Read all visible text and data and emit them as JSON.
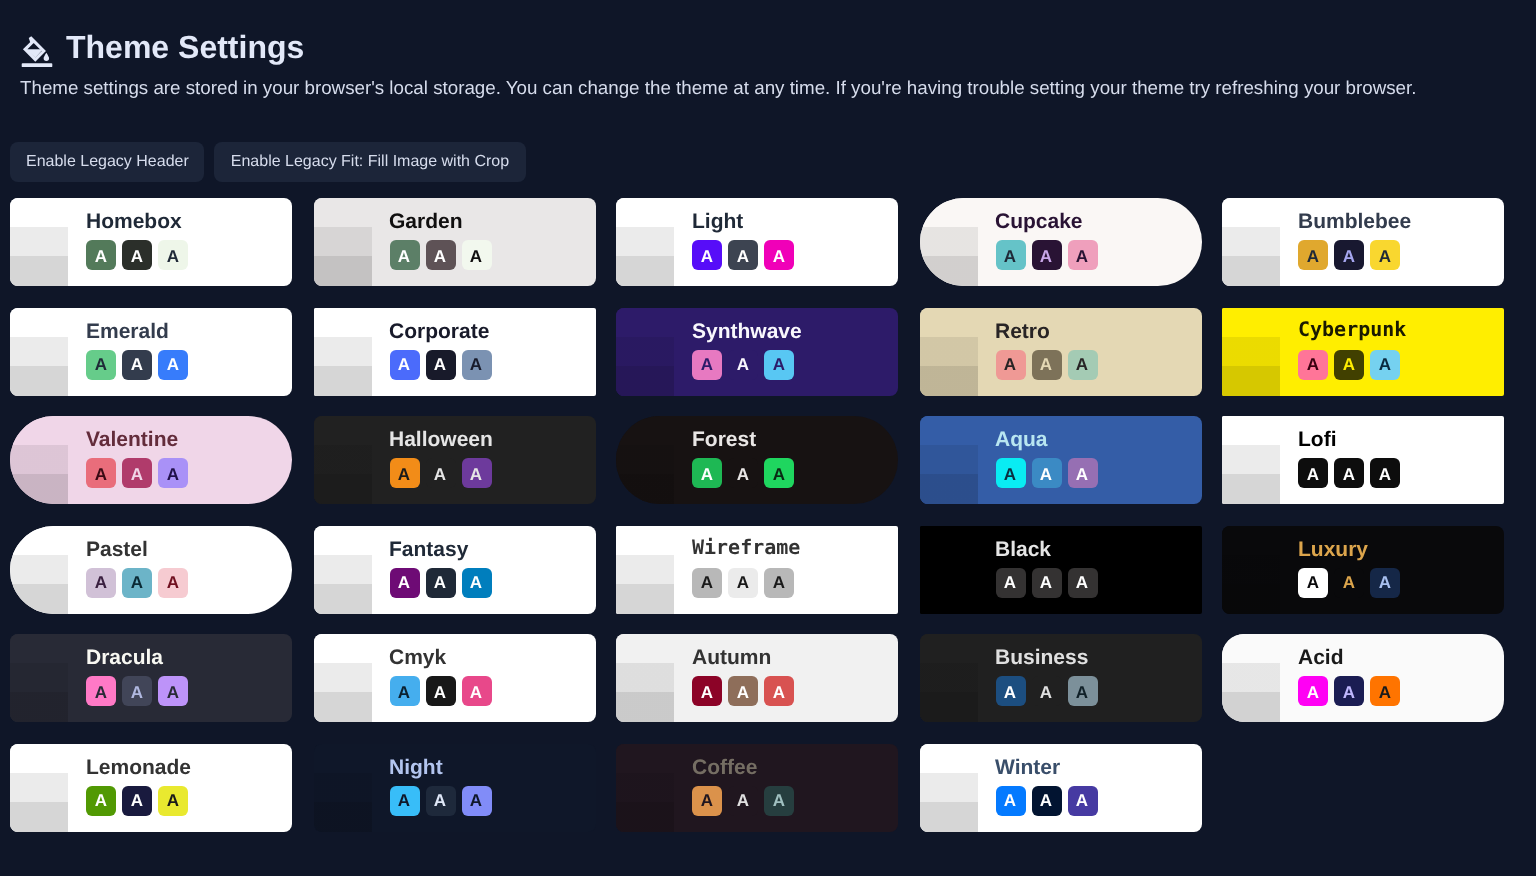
{
  "header": {
    "title": "Theme Settings",
    "description": "Theme settings are stored in your browser's local storage. You can change the theme at any time. If you're having trouble setting your theme try refreshing your browser."
  },
  "buttons": [
    "Enable Legacy Header",
    "Enable Legacy Fit: Fill Image with Crop"
  ],
  "themes": [
    {
      "kind": "soft",
      "color": "#ffffff",
      "name": {
        "text": "Homebox",
        "color": "#1f2937"
      },
      "swatches": [
        {
          "color": "#537a5a",
          "letter": {
            "text": "A",
            "color": "#ffffff"
          }
        },
        {
          "color": "#2b2f2a",
          "letter": {
            "text": "A",
            "color": "#ffffff"
          }
        },
        {
          "color": "#eef6e9",
          "letter": {
            "text": "A",
            "color": "#1f2937"
          }
        }
      ]
    },
    {
      "kind": "soft",
      "color": "#e9e7e7",
      "name": {
        "text": "Garden",
        "color": "#100f0f"
      },
      "swatches": [
        {
          "color": "#5c7f67",
          "letter": {
            "text": "A",
            "color": "#ffffff"
          }
        },
        {
          "color": "#5e5256",
          "letter": {
            "text": "A",
            "color": "#ffffff"
          }
        },
        {
          "color": "#f2f8ee",
          "letter": {
            "text": "A",
            "color": "#100f0f"
          }
        }
      ]
    },
    {
      "kind": "soft",
      "color": "#ffffff",
      "name": {
        "text": "Light",
        "color": "#1f2937"
      },
      "swatches": [
        {
          "color": "#570df8",
          "letter": {
            "text": "A",
            "color": "#ffffff"
          }
        },
        {
          "color": "#3d4451",
          "letter": {
            "text": "A",
            "color": "#ffffff"
          }
        },
        {
          "color": "#f000b8",
          "letter": {
            "text": "A",
            "color": "#ffffff"
          }
        }
      ]
    },
    {
      "kind": "pill",
      "color": "#faf7f5",
      "name": {
        "text": "Cupcake",
        "color": "#291334"
      },
      "swatches": [
        {
          "color": "#65c3c8",
          "letter": {
            "text": "A",
            "color": "#1f2937"
          }
        },
        {
          "color": "#291334",
          "letter": {
            "text": "A",
            "color": "#c9a6e8"
          }
        },
        {
          "color": "#ef9fbc",
          "letter": {
            "text": "A",
            "color": "#291334"
          }
        }
      ]
    },
    {
      "kind": "soft",
      "color": "#ffffff",
      "name": {
        "text": "Bumblebee",
        "color": "#333c4d"
      },
      "swatches": [
        {
          "color": "#e0a82e",
          "letter": {
            "text": "A",
            "color": "#1f2937"
          }
        },
        {
          "color": "#181830",
          "letter": {
            "text": "A",
            "color": "#a6a6f0"
          }
        },
        {
          "color": "#f9d72f",
          "letter": {
            "text": "A",
            "color": "#1f2937"
          }
        }
      ]
    },
    {
      "kind": "soft",
      "color": "#ffffff",
      "name": {
        "text": "Emerald",
        "color": "#333c4d"
      },
      "swatches": [
        {
          "color": "#66cc8a",
          "letter": {
            "text": "A",
            "color": "#1f2937"
          }
        },
        {
          "color": "#333c4d",
          "letter": {
            "text": "A",
            "color": "#ffffff"
          }
        },
        {
          "color": "#377cfb",
          "letter": {
            "text": "A",
            "color": "#ffffff"
          }
        }
      ]
    },
    {
      "kind": "sharp",
      "color": "#ffffff",
      "name": {
        "text": "Corporate",
        "color": "#181a2a"
      },
      "swatches": [
        {
          "color": "#4b6bfb",
          "letter": {
            "text": "A",
            "color": "#ffffff"
          }
        },
        {
          "color": "#181a2a",
          "letter": {
            "text": "A",
            "color": "#ffffff"
          }
        },
        {
          "color": "#7b92b2",
          "letter": {
            "text": "A",
            "color": "#181a2a"
          }
        }
      ]
    },
    {
      "kind": "soft",
      "color": "#2d1b69",
      "name": {
        "text": "Synthwave",
        "color": "#f9f7fd"
      },
      "swatches": [
        {
          "color": "#e779c1",
          "letter": {
            "text": "A",
            "color": "#2d1b69"
          }
        },
        {
          "color": "#2d1b69",
          "letter": {
            "text": "A",
            "color": "#f9f7fd"
          }
        },
        {
          "color": "#58c7f3",
          "letter": {
            "text": "A",
            "color": "#2d1b69"
          }
        }
      ]
    },
    {
      "kind": "soft",
      "color": "#e4d8b4",
      "name": {
        "text": "Retro",
        "color": "#282425"
      },
      "swatches": [
        {
          "color": "#ef9995",
          "letter": {
            "text": "A",
            "color": "#282425"
          }
        },
        {
          "color": "#7d7259",
          "letter": {
            "text": "A",
            "color": "#e4d8b4"
          }
        },
        {
          "color": "#a4cbb4",
          "letter": {
            "text": "A",
            "color": "#282425"
          }
        }
      ]
    },
    {
      "kind": "mono",
      "color": "#ffee00",
      "name": {
        "text": "Cyberpunk",
        "color": "#1a1a00"
      },
      "swatches": [
        {
          "color": "#ff7598",
          "letter": {
            "text": "A",
            "color": "#3a0010"
          }
        },
        {
          "color": "#414000",
          "letter": {
            "text": "A",
            "color": "#ffee00"
          }
        },
        {
          "color": "#75d1f0",
          "letter": {
            "text": "A",
            "color": "#0a2a40"
          }
        }
      ]
    },
    {
      "kind": "pill",
      "color": "#f0d6e8",
      "name": {
        "text": "Valentine",
        "color": "#632c3b"
      },
      "swatches": [
        {
          "color": "#e96d7b",
          "letter": {
            "text": "A",
            "color": "#3a0a14"
          }
        },
        {
          "color": "#b03b6b",
          "letter": {
            "text": "A",
            "color": "#f0d6e8"
          }
        },
        {
          "color": "#a991f7",
          "letter": {
            "text": "A",
            "color": "#20104a"
          }
        }
      ]
    },
    {
      "kind": "soft",
      "color": "#212121",
      "name": {
        "text": "Halloween",
        "color": "#e5e5e5"
      },
      "swatches": [
        {
          "color": "#f28c18",
          "letter": {
            "text": "A",
            "color": "#1a1a1a"
          }
        },
        {
          "color": "#212121",
          "letter": {
            "text": "A",
            "color": "#e5e5e5"
          }
        },
        {
          "color": "#6d3a9c",
          "letter": {
            "text": "A",
            "color": "#e5e5e5"
          }
        }
      ]
    },
    {
      "kind": "pill",
      "color": "#171212",
      "name": {
        "text": "Forest",
        "color": "#e9e6e5"
      },
      "swatches": [
        {
          "color": "#1eb854",
          "letter": {
            "text": "A",
            "color": "#ffffff"
          }
        },
        {
          "color": "#171212",
          "letter": {
            "text": "A",
            "color": "#e9e6e5"
          }
        },
        {
          "color": "#1fd65f",
          "letter": {
            "text": "A",
            "color": "#0a2a14"
          }
        }
      ]
    },
    {
      "kind": "soft",
      "color": "#345da7",
      "name": {
        "text": "Aqua",
        "color": "#b8e6f1"
      },
      "swatches": [
        {
          "color": "#09ecf3",
          "letter": {
            "text": "A",
            "color": "#0a3040"
          }
        },
        {
          "color": "#3b8ac4",
          "letter": {
            "text": "A",
            "color": "#ffffff"
          }
        },
        {
          "color": "#966fb3",
          "letter": {
            "text": "A",
            "color": "#ffffff"
          }
        }
      ]
    },
    {
      "kind": "sharp",
      "color": "#ffffff",
      "name": {
        "text": "Lofi",
        "color": "#000000"
      },
      "swatches": [
        {
          "color": "#0d0d0d",
          "letter": {
            "text": "A",
            "color": "#ffffff"
          }
        },
        {
          "color": "#0d0d0d",
          "letter": {
            "text": "A",
            "color": "#ffffff"
          }
        },
        {
          "color": "#0d0d0d",
          "letter": {
            "text": "A",
            "color": "#ffffff"
          }
        }
      ]
    },
    {
      "kind": "pill",
      "color": "#ffffff",
      "name": {
        "text": "Pastel",
        "color": "#333333"
      },
      "swatches": [
        {
          "color": "#d1c1d7",
          "letter": {
            "text": "A",
            "color": "#3a2040"
          }
        },
        {
          "color": "#6cb4c8",
          "letter": {
            "text": "A",
            "color": "#0a2a35"
          }
        },
        {
          "color": "#f6cbd1",
          "letter": {
            "text": "A",
            "color": "#701020"
          }
        }
      ]
    },
    {
      "kind": "soft",
      "color": "#ffffff",
      "name": {
        "text": "Fantasy",
        "color": "#1f2937"
      },
      "swatches": [
        {
          "color": "#6e0b75",
          "letter": {
            "text": "A",
            "color": "#ffffff"
          }
        },
        {
          "color": "#1f2937",
          "letter": {
            "text": "A",
            "color": "#ffffff"
          }
        },
        {
          "color": "#007ebd",
          "letter": {
            "text": "A",
            "color": "#ffffff"
          }
        }
      ]
    },
    {
      "kind": "mono",
      "color": "#ffffff",
      "name": {
        "text": "Wireframe",
        "color": "#333333"
      },
      "swatches": [
        {
          "color": "#b8b8b8",
          "letter": {
            "text": "A",
            "color": "#1a1a1a"
          }
        },
        {
          "color": "#ebebeb",
          "letter": {
            "text": "A",
            "color": "#1a1a1a"
          }
        },
        {
          "color": "#b8b8b8",
          "letter": {
            "text": "A",
            "color": "#1a1a1a"
          }
        }
      ]
    },
    {
      "kind": "sharp",
      "color": "#000000",
      "name": {
        "text": "Black",
        "color": "#e5e5e5"
      },
      "swatches": [
        {
          "color": "#343232",
          "letter": {
            "text": "A",
            "color": "#ffffff"
          }
        },
        {
          "color": "#343232",
          "letter": {
            "text": "A",
            "color": "#ffffff"
          }
        },
        {
          "color": "#343232",
          "letter": {
            "text": "A",
            "color": "#ffffff"
          }
        }
      ]
    },
    {
      "kind": "soft",
      "color": "#09090b",
      "name": {
        "text": "Luxury",
        "color": "#dca54c"
      },
      "swatches": [
        {
          "color": "#ffffff",
          "letter": {
            "text": "A",
            "color": "#09090b"
          }
        },
        {
          "color": "#09090b",
          "letter": {
            "text": "A",
            "color": "#dca54c"
          }
        },
        {
          "color": "#152747",
          "letter": {
            "text": "A",
            "color": "#a8c0f0"
          }
        }
      ]
    },
    {
      "kind": "soft",
      "color": "#282a36",
      "name": {
        "text": "Dracula",
        "color": "#f8f8f2"
      },
      "swatches": [
        {
          "color": "#ff79c6",
          "letter": {
            "text": "A",
            "color": "#282a36"
          }
        },
        {
          "color": "#414558",
          "letter": {
            "text": "A",
            "color": "#b0b8e0"
          }
        },
        {
          "color": "#bd93f9",
          "letter": {
            "text": "A",
            "color": "#282a36"
          }
        }
      ]
    },
    {
      "kind": "soft",
      "color": "#ffffff",
      "name": {
        "text": "Cmyk",
        "color": "#333333"
      },
      "swatches": [
        {
          "color": "#45aeee",
          "letter": {
            "text": "A",
            "color": "#0a2030"
          }
        },
        {
          "color": "#181818",
          "letter": {
            "text": "A",
            "color": "#ffffff"
          }
        },
        {
          "color": "#e8488a",
          "letter": {
            "text": "A",
            "color": "#ffffff"
          }
        }
      ]
    },
    {
      "kind": "soft",
      "color": "#f1f1f1",
      "name": {
        "text": "Autumn",
        "color": "#333333"
      },
      "swatches": [
        {
          "color": "#8c0327",
          "letter": {
            "text": "A",
            "color": "#ffffff"
          }
        },
        {
          "color": "#8e6e5a",
          "letter": {
            "text": "A",
            "color": "#ffffff"
          }
        },
        {
          "color": "#d85251",
          "letter": {
            "text": "A",
            "color": "#ffffff"
          }
        }
      ]
    },
    {
      "kind": "soft",
      "color": "#202020",
      "name": {
        "text": "Business",
        "color": "#e0e0e0"
      },
      "swatches": [
        {
          "color": "#1c4e80",
          "letter": {
            "text": "A",
            "color": "#ffffff"
          }
        },
        {
          "color": "#202020",
          "letter": {
            "text": "A",
            "color": "#e0e0e0"
          }
        },
        {
          "color": "#7c909a",
          "letter": {
            "text": "A",
            "color": "#102028"
          }
        }
      ]
    },
    {
      "kind": "round",
      "color": "#fafafa",
      "name": {
        "text": "Acid",
        "color": "#1a1a1a"
      },
      "swatches": [
        {
          "color": "#ff00f4",
          "letter": {
            "text": "A",
            "color": "#ffffff"
          }
        },
        {
          "color": "#1b1d53",
          "letter": {
            "text": "A",
            "color": "#c0b8ff"
          }
        },
        {
          "color": "#ff7400",
          "letter": {
            "text": "A",
            "color": "#1a1a1a"
          }
        }
      ]
    },
    {
      "kind": "soft",
      "color": "#ffffff",
      "name": {
        "text": "Lemonade",
        "color": "#333333"
      },
      "swatches": [
        {
          "color": "#519903",
          "letter": {
            "text": "A",
            "color": "#ffffff"
          }
        },
        {
          "color": "#191a3e",
          "letter": {
            "text": "A",
            "color": "#ffffff"
          }
        },
        {
          "color": "#e9e92f",
          "letter": {
            "text": "A",
            "color": "#1a1a1a"
          }
        }
      ]
    },
    {
      "kind": "soft",
      "color": "#0f1729",
      "name": {
        "text": "Night",
        "color": "#b3c5ef"
      },
      "swatches": [
        {
          "color": "#38bdf8",
          "letter": {
            "text": "A",
            "color": "#0f1729"
          }
        },
        {
          "color": "#1e293b",
          "letter": {
            "text": "A",
            "color": "#e0e8f8"
          }
        },
        {
          "color": "#818cf8",
          "letter": {
            "text": "A",
            "color": "#0f1729"
          }
        }
      ]
    },
    {
      "kind": "soft",
      "color": "#20161f",
      "name": {
        "text": "Coffee",
        "color": "#756e63"
      },
      "swatches": [
        {
          "color": "#db924b",
          "letter": {
            "text": "A",
            "color": "#20161f"
          }
        },
        {
          "color": "#20161f",
          "letter": {
            "text": "A",
            "color": "#e0e0e0"
          }
        },
        {
          "color": "#263e3f",
          "letter": {
            "text": "A",
            "color": "#a0c0c0"
          }
        }
      ]
    },
    {
      "kind": "soft",
      "color": "#ffffff",
      "name": {
        "text": "Winter",
        "color": "#394e6a"
      },
      "swatches": [
        {
          "color": "#047aff",
          "letter": {
            "text": "A",
            "color": "#ffffff"
          }
        },
        {
          "color": "#021431",
          "letter": {
            "text": "A",
            "color": "#ffffff"
          }
        },
        {
          "color": "#463aa2",
          "letter": {
            "text": "A",
            "color": "#ffffff"
          }
        }
      ]
    }
  ]
}
